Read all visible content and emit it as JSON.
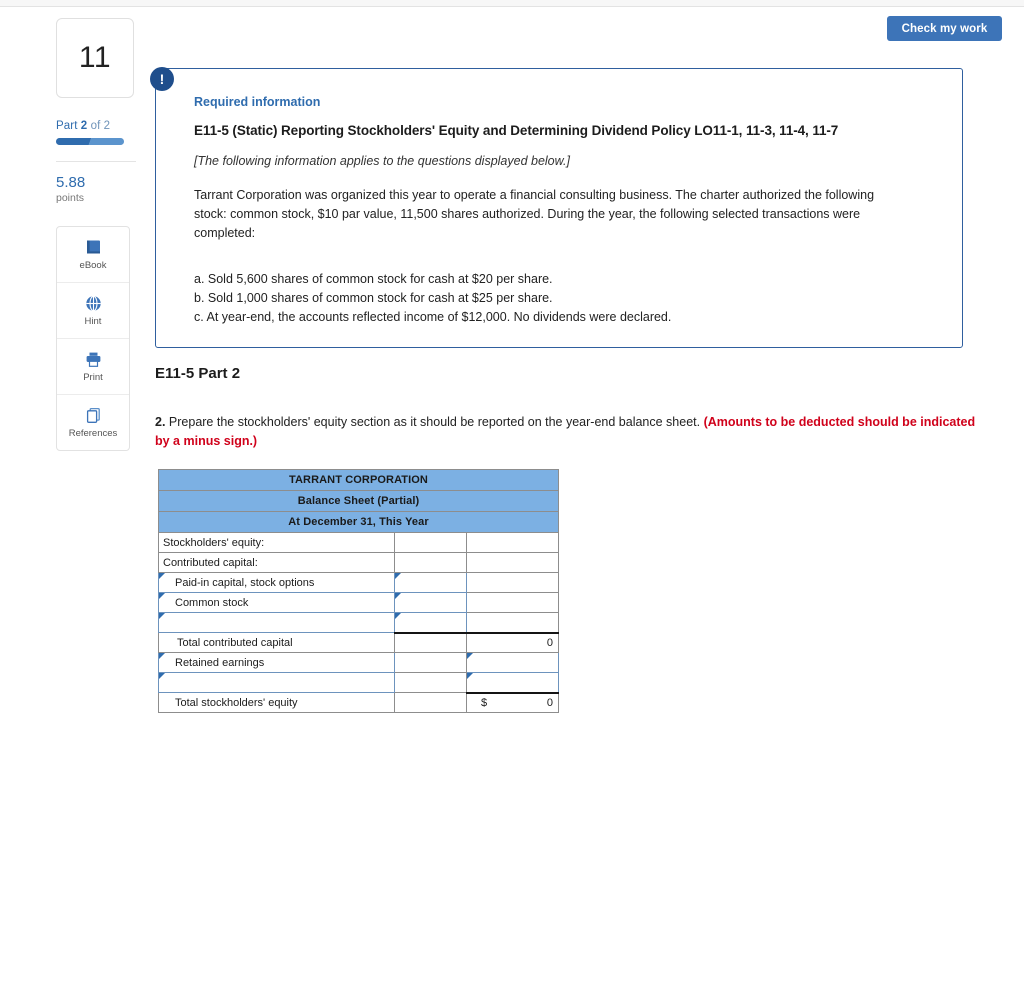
{
  "toolbar": {
    "check_my_work": "Check my work"
  },
  "rail": {
    "question_number": "11",
    "part_prefix": "Part",
    "part_current": "2",
    "part_suffix": "of 2",
    "points_value": "5.88",
    "points_label": "points",
    "tools": [
      {
        "label": "eBook",
        "icon": "book-icon"
      },
      {
        "label": "Hint",
        "icon": "globe-icon"
      },
      {
        "label": "Print",
        "icon": "printer-icon"
      },
      {
        "label": "References",
        "icon": "copy-pages-icon"
      }
    ]
  },
  "required_information": {
    "badge": "!",
    "kicker": "Required information",
    "title": "E11-5 (Static) Reporting Stockholders' Equity and Determining Dividend Policy LO11-1, 11-3, 11-4, 11-7",
    "applies_note": "[The following information applies to the questions displayed below.]",
    "body": "Tarrant Corporation was organized this year to operate a financial consulting business. The charter authorized the following stock: common stock, $10 par value, 11,500 shares authorized. During the year, the following selected transactions were completed:",
    "transactions": [
      "a. Sold 5,600 shares of common stock for cash at $20 per share.",
      "b. Sold 1,000 shares of common stock for cash at $25 per share.",
      "c. At year-end, the accounts reflected income of $12,000. No dividends were declared."
    ]
  },
  "part": {
    "heading": "E11-5 Part 2",
    "question_number": "2.",
    "instruction_text": " Prepare the stockholders' equity section as it should be reported on the year-end balance sheet. ",
    "instruction_warning": "(Amounts to be deducted should be indicated by a minus sign.)"
  },
  "worksheet": {
    "header_rows": [
      "TARRANT CORPORATION",
      "Balance Sheet (Partial)",
      "At December 31, This Year"
    ],
    "rows": [
      {
        "label": "Stockholders' equity:",
        "indent": 0,
        "label_input": false,
        "col_b": "",
        "col_b_input": false,
        "col_c": "",
        "col_c_input": false
      },
      {
        "label": "Contributed capital:",
        "indent": 0,
        "label_input": false,
        "col_b": "",
        "col_b_input": false,
        "col_c": "",
        "col_c_input": false
      },
      {
        "label": "Paid-in capital, stock options",
        "indent": 1,
        "label_input": true,
        "col_b": "",
        "col_b_input": true,
        "col_c": "",
        "col_c_input": false
      },
      {
        "label": "Common stock",
        "indent": 1,
        "label_input": true,
        "col_b": "",
        "col_b_input": true,
        "col_c": "",
        "col_c_input": false
      },
      {
        "label": "",
        "indent": 1,
        "label_input": true,
        "col_b": "",
        "col_b_input": true,
        "col_c": "",
        "col_c_input": false
      },
      {
        "label": "Total contributed capital",
        "indent": 2,
        "label_input": false,
        "col_b": "",
        "col_b_input": false,
        "col_c": "0",
        "col_c_input": false
      },
      {
        "label": "Retained earnings",
        "indent": 1,
        "label_input": true,
        "col_b": "",
        "col_b_input": false,
        "col_c": "",
        "col_c_input": true
      },
      {
        "label": "",
        "indent": 1,
        "label_input": true,
        "col_b": "",
        "col_b_input": false,
        "col_c": "",
        "col_c_input": true
      },
      {
        "label": "Total stockholders' equity",
        "indent": 1,
        "label_input": false,
        "col_b": "",
        "col_b_input": false,
        "col_c": "0",
        "col_c_currency": "$",
        "col_c_input": false
      }
    ]
  },
  "colors": {
    "accent_blue": "#3d74b8",
    "header_blue": "#7cb0e3",
    "link_blue": "#2f6cae",
    "warning_red": "#d0021b",
    "badge_blue": "#1f4e8c"
  }
}
